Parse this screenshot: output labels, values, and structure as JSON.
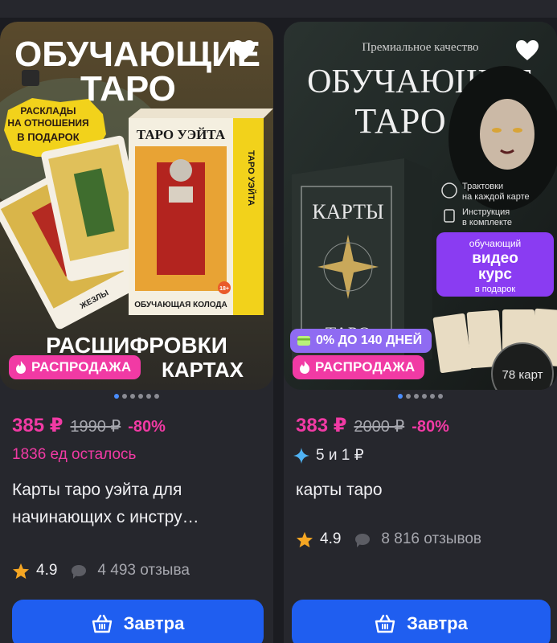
{
  "products": [
    {
      "image": {
        "headline": "ОБУЧАЮЩИЕ",
        "headline2": "ТАРО",
        "gift_line1": "РАСКЛАДЫ",
        "gift_line2": "НА ОТНОШЕНИЯ",
        "gift_line3": "В ПОДАРОК",
        "box_title": "ТАРО УЭЙТА",
        "box_side": "ТАРО УЭЙТА",
        "box_bottom": "ОБУЧАЮЩАЯ КОЛОДА",
        "age": "18+",
        "card_label": "ЖЕЗЛЫ",
        "bottom_line1": "РАСШИФРОВКИ",
        "bottom_line2": "КАРТАХ"
      },
      "sale_badge": "РАСПРОДАЖА",
      "price": "385 ₽",
      "old_price": "1990 ₽",
      "discount": "-80%",
      "stock": "1836 ед осталось",
      "title": "Карты таро уэйта для начинающих с инстру…",
      "rating": "4.9",
      "reviews": "4 493 отзыва",
      "cta": "Завтра"
    },
    {
      "image": {
        "top_text": "Премиальное качество",
        "headline": "ОБУЧАЮЩИЕ",
        "headline2": "ТАРО",
        "box_title": "КАРТЫ",
        "box_bottom": "ТАРО",
        "feature1_line1": "Трактовки",
        "feature1_line2": "на каждой карте",
        "feature2_line1": "Инструкция",
        "feature2_line2": "в комплекте",
        "promo_line1": "обучающий",
        "promo_line2": "видео",
        "promo_line3": "курс",
        "promo_line4": "в подарок",
        "count_text": "78 карт"
      },
      "credit_badge": "0% ДО 140 ДНЕЙ",
      "sale_badge": "РАСПРОДАЖА",
      "price": "383 ₽",
      "old_price": "2000 ₽",
      "discount": "-80%",
      "bonus": "5 и 1 ₽",
      "title": "карты таро",
      "rating": "4.9",
      "reviews": "8 816 отзывов",
      "cta": "Завтра"
    }
  ],
  "colors": {
    "accent_pink": "#f13aa4",
    "accent_blue": "#1f5ef0",
    "credit_purple": "#8f6bf2",
    "star": "#f5a623"
  }
}
